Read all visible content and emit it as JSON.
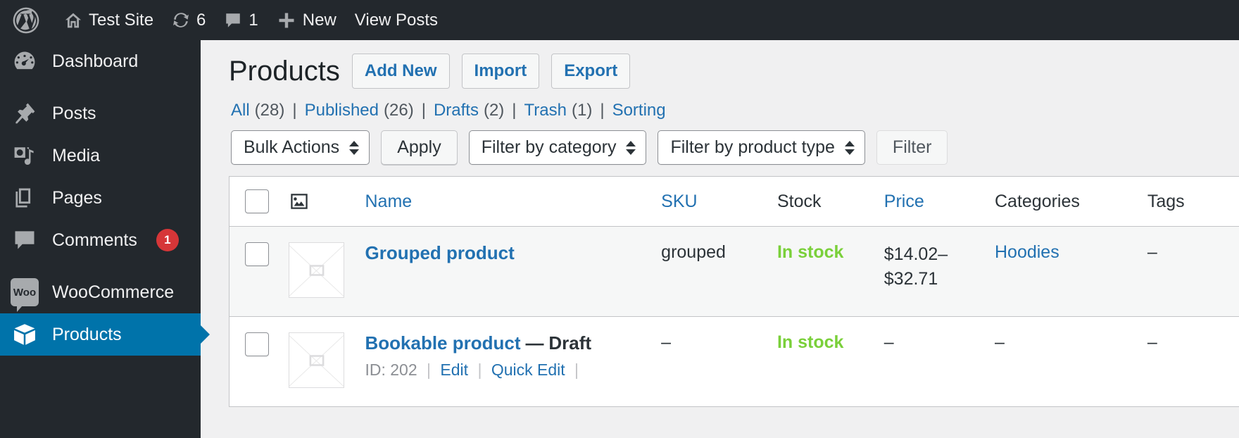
{
  "adminbar": {
    "logo": "wordpress-logo-icon",
    "site_name": "Test Site",
    "updates_icon": "updates-icon",
    "updates_count": "6",
    "comments_icon": "comment-bubble-icon",
    "comments_count": "1",
    "new_icon": "plus-icon",
    "new_label": "New",
    "view_posts_label": "View Posts"
  },
  "sidebar": {
    "items": [
      {
        "label": "Dashboard",
        "icon": "dashboard-icon",
        "current": false
      },
      {
        "label": "Posts",
        "icon": "pin-icon",
        "current": false
      },
      {
        "label": "Media",
        "icon": "media-icon",
        "current": false
      },
      {
        "label": "Pages",
        "icon": "pages-icon",
        "current": false
      },
      {
        "label": "Comments",
        "icon": "comment-bubble-icon",
        "current": false,
        "badge": "1"
      },
      {
        "label": "WooCommerce",
        "icon": "woo-icon",
        "current": false,
        "badge_text": "Woo"
      },
      {
        "label": "Products",
        "icon": "product-box-icon",
        "current": true
      }
    ]
  },
  "page": {
    "title": "Products",
    "actions": [
      {
        "label": "Add New"
      },
      {
        "label": "Import"
      },
      {
        "label": "Export"
      }
    ]
  },
  "status_links": [
    {
      "label": "All",
      "count": "(28)"
    },
    {
      "label": "Published",
      "count": "(26)"
    },
    {
      "label": "Drafts",
      "count": "(2)"
    },
    {
      "label": "Trash",
      "count": "(1)"
    },
    {
      "label": "Sorting",
      "count": ""
    }
  ],
  "tablenav": {
    "bulk_actions_label": "Bulk Actions",
    "apply_label": "Apply",
    "filter_category_label": "Filter by category",
    "filter_product_type_label": "Filter by product type",
    "filter_label": "Filter"
  },
  "table": {
    "columns": {
      "cb": "select-all",
      "thumb": "image-icon",
      "name": "Name",
      "sku": "SKU",
      "stock": "Stock",
      "price": "Price",
      "categories": "Categories",
      "tags": "Tags"
    },
    "rows": [
      {
        "name": "Grouped product",
        "state": "",
        "state_dash": "",
        "sku": "grouped",
        "stock": "In stock",
        "price_line1": "$14.02–",
        "price_line2": "$32.71",
        "categories": "Hoodies",
        "categories_is_link": true,
        "tags": "–",
        "row_actions": null
      },
      {
        "name": "Bookable product",
        "state": "Draft",
        "state_dash": "—",
        "sku": "–",
        "stock": "In stock",
        "price_line1": "–",
        "price_line2": "",
        "categories": "–",
        "categories_is_link": false,
        "tags": "–",
        "row_actions": {
          "id_label": "ID: 202",
          "edit": "Edit",
          "quick_edit": "Quick Edit"
        }
      }
    ]
  },
  "colors": {
    "admin_bg": "#23282d",
    "accent_blue": "#2271b1",
    "current_menu": "#0073aa",
    "in_stock_green": "#7ad03a",
    "badge_red": "#d63638",
    "content_bg": "#f0f0f1"
  }
}
